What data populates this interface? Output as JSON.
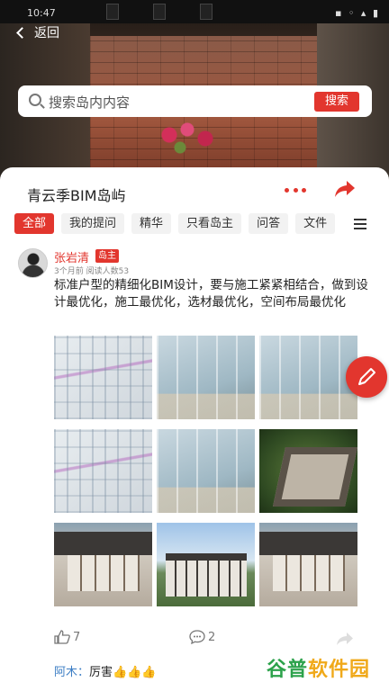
{
  "status_bar": {
    "time": "10:47",
    "icons": "▪ ◦ ▴ ▮"
  },
  "nav": {
    "back_label": "返回"
  },
  "search": {
    "placeholder": "搜索岛内内容",
    "button_label": "搜索"
  },
  "island": {
    "title": "青云季BIM岛屿"
  },
  "tabs": [
    {
      "label": "全部",
      "active": true
    },
    {
      "label": "我的提问",
      "active": false
    },
    {
      "label": "精华",
      "active": false
    },
    {
      "label": "只看岛主",
      "active": false
    },
    {
      "label": "问答",
      "active": false
    },
    {
      "label": "文件",
      "active": false
    }
  ],
  "post": {
    "author": "张岩清",
    "author_badge": "岛主",
    "meta": "3个月前 阅读人数53",
    "text": "标准户型的精细化BIM设计，要与施工紧紧相结合，做到设计最优化，施工最优化，选材最优化，空间布局最优化",
    "likes": "7",
    "comments": "2",
    "reply": {
      "user": "阿木：",
      "text": "厉害👍👍👍"
    }
  },
  "images": [
    "bim-pipe-model-1",
    "bim-room-render-1",
    "bim-room-render-2",
    "bim-pipe-model-2",
    "bim-room-render-3",
    "aerial-courtyard",
    "courtyard-building-1",
    "town-street-render",
    "courtyard-building-2"
  ],
  "watermark": {
    "part1": "谷普",
    "part2": "软件园"
  },
  "colors": {
    "accent": "#e2362e",
    "link": "#3b7dc4"
  }
}
